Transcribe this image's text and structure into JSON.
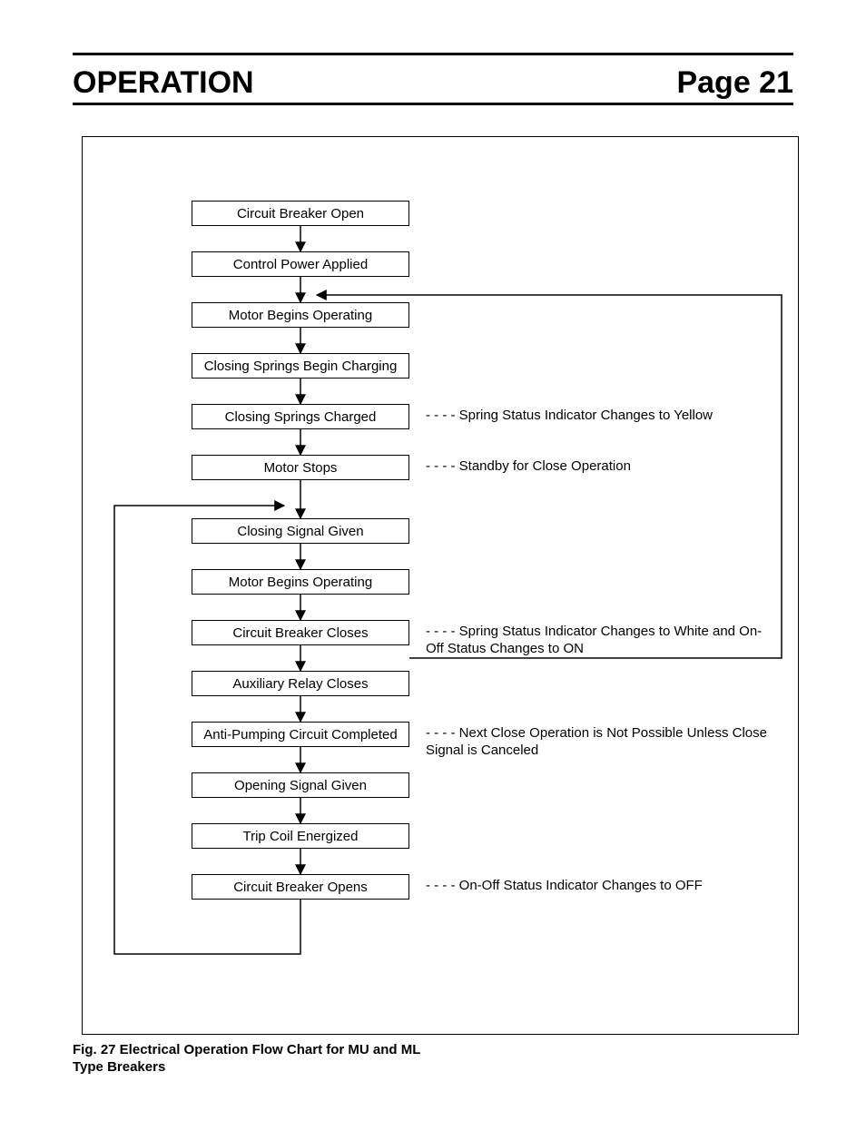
{
  "header": {
    "section_title": "OPERATION",
    "page_label": "Page 21"
  },
  "caption": "Fig. 27  Electrical Operation Flow Chart for MU and ML Type Breakers",
  "dash": "- - - -",
  "steps": [
    {
      "label": "Circuit Breaker Open"
    },
    {
      "label": "Control Power Applied"
    },
    {
      "label": "Motor Begins Operating"
    },
    {
      "label": "Closing Springs Begin Charging"
    },
    {
      "label": "Closing Springs Charged",
      "note": "Spring Status Indicator  Changes to Yellow"
    },
    {
      "label": "Motor Stops",
      "note": "Standby for Close Operation"
    },
    {
      "label": "Closing Signal Given"
    },
    {
      "label": "Motor Begins Operating"
    },
    {
      "label": "Circuit Breaker Closes",
      "note": "Spring Status Indicator Changes to White and On-Off Status Changes to ON"
    },
    {
      "label": "Auxiliary Relay Closes"
    },
    {
      "label": "Anti-Pumping Circuit Completed",
      "note": "Next Close Operation is Not Possible Unless Close Signal is Canceled"
    },
    {
      "label": "Opening Signal Given"
    },
    {
      "label": "Trip Coil Energized"
    },
    {
      "label": "Circuit Breaker Opens",
      "note": "On-Off Status Indicator Changes to OFF"
    }
  ]
}
